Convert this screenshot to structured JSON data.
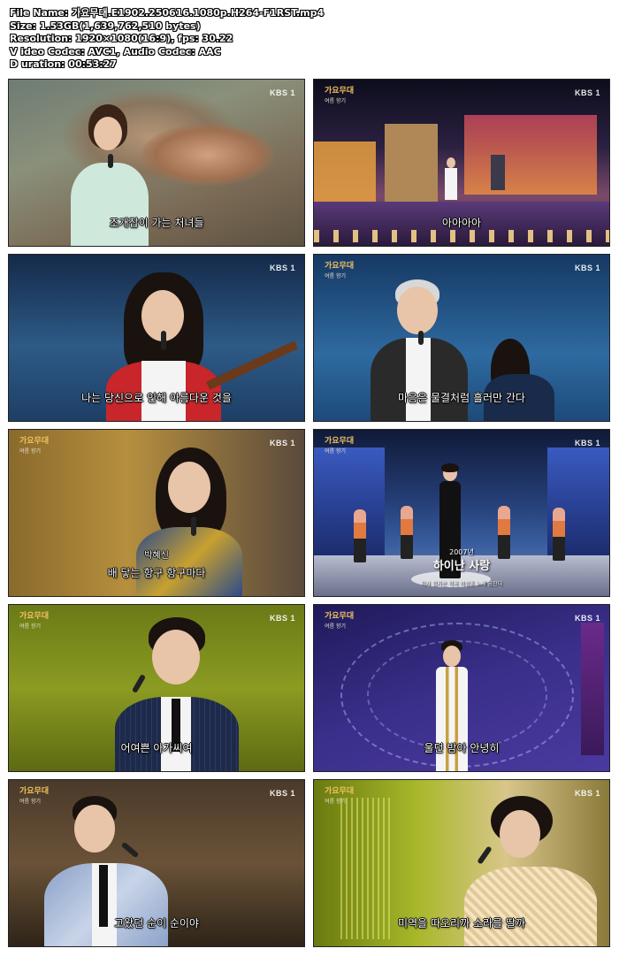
{
  "info": {
    "file_name": "File Name: 가요무대.E1902.250616.1080p.H264-F1RST.mp4",
    "size": "Size: 1.53GB(1,639,762,510 bytes)",
    "resolution": "Resolution: 1920×1080(16:9), fps: 30.22",
    "codec": "V ideo Codec: AVC1, Audio Codec: AAC",
    "duration": "D uration: 00:53:27"
  },
  "watermark": "KBS 1",
  "show_logo": "가요무대",
  "show_logo_sub": "여름 향기",
  "thumbs": [
    {
      "subtitle": "조개잡이 가는 처녀들"
    },
    {
      "subtitle": "아아아아"
    },
    {
      "subtitle": "나는 당신으로 인해 아름다운 것을"
    },
    {
      "subtitle": "마음은 물결처럼 흘러만 간다"
    },
    {
      "subtitle": "배 닿는 항구 항구마다",
      "name": "박혜신"
    },
    {
      "song_year": "2007년",
      "song_title": "하이난 사랑",
      "song_credit": "작사 정가은  작곡 박성훈  노래 금잔디"
    },
    {
      "subtitle": "어여쁜 아가씨여"
    },
    {
      "subtitle": "울던 밤아 안녕히"
    },
    {
      "subtitle": "고왔던 순이 순이야"
    },
    {
      "subtitle": "미역을 따오리까 소라를 딸까"
    }
  ]
}
